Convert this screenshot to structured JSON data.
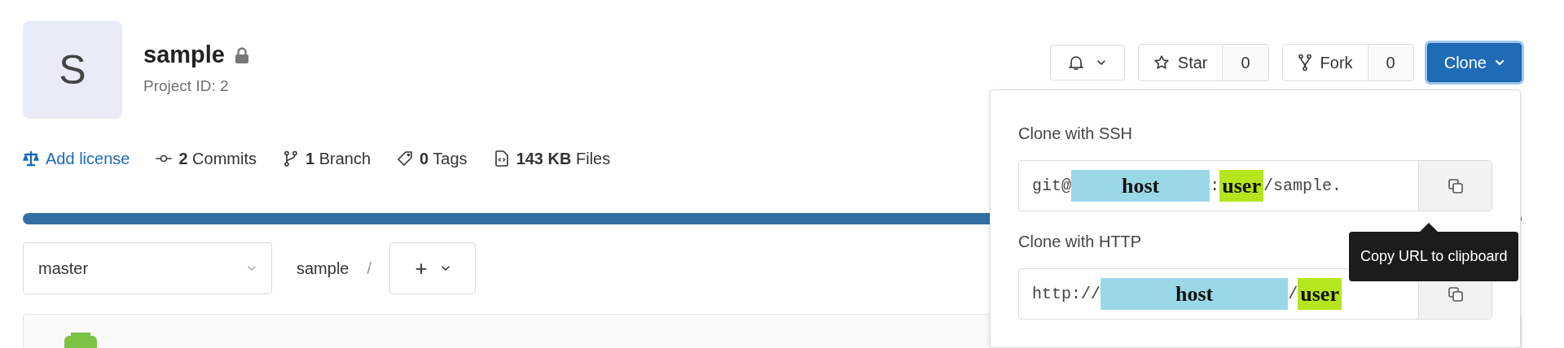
{
  "project": {
    "avatar_letter": "S",
    "name": "sample",
    "private": true,
    "id_label": "Project ID: 2"
  },
  "actions": {
    "star": {
      "label": "Star",
      "count": "0"
    },
    "fork": {
      "label": "Fork",
      "count": "0"
    },
    "clone": {
      "label": "Clone",
      "expanded": true
    }
  },
  "stats": [
    {
      "kind": "license",
      "label": "Add license"
    },
    {
      "kind": "commits",
      "count": "2",
      "label": "Commits"
    },
    {
      "kind": "branches",
      "count": "1",
      "label": "Branch"
    },
    {
      "kind": "tags",
      "count": "0",
      "label": "Tags"
    },
    {
      "kind": "files",
      "count": "143 KB",
      "label": "Files"
    }
  ],
  "language_bar": {
    "level": 1
  },
  "branch_select": {
    "value": "master"
  },
  "breadcrumb": {
    "path": "sample",
    "separator": "/",
    "add_label": "+"
  },
  "clone_menu": {
    "sections": [
      {
        "title": "Clone with SSH",
        "segments": [
          {
            "text": "git@"
          },
          {
            "text": "host",
            "color": "#9ad8e8"
          },
          {
            "text": ":"
          },
          {
            "text": "user",
            "color": "#b5e61d"
          },
          {
            "text": "/sample."
          }
        ],
        "tooltip": "Copy URL to clipboard"
      },
      {
        "title": "Clone with HTTP",
        "segments": [
          {
            "text": "http://"
          },
          {
            "text": "host",
            "color": "#9ad8e8"
          },
          {
            "text": "/"
          },
          {
            "text": "user",
            "color": "#b5e61d"
          }
        ]
      }
    ]
  }
}
